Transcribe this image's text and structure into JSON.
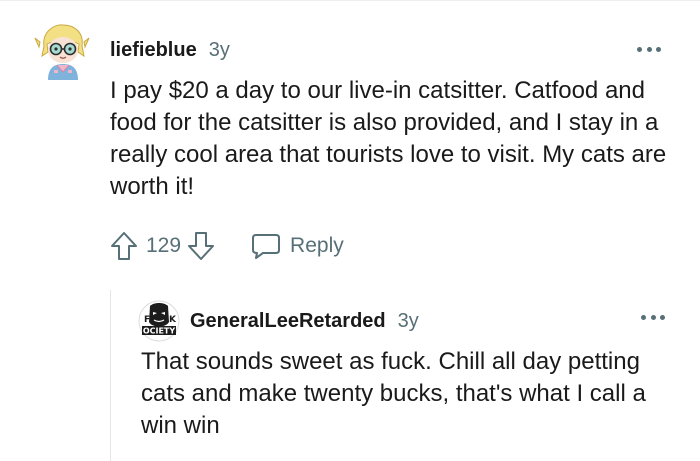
{
  "comments": [
    {
      "username": "liefieblue",
      "age": "3y",
      "body": "I pay $20 a day to our live-in catsitter. Catfood and food for the catsitter is also provided, and I stay in a really cool area that tourists love to visit. My cats are worth it!",
      "score": "129",
      "reply_label": "Reply",
      "avatar": "cartoon-snoo-avatar",
      "icons": {
        "upvote": "arrow-up-icon",
        "downvote": "arrow-down-icon",
        "reply": "speech-bubble-icon",
        "more": "ellipsis-icon"
      }
    },
    {
      "username": "GeneralLeeRetarded",
      "age": "3y",
      "body": "That sounds sweet as fuck. Chill all day petting cats and make twenty bucks, that's what I call a win win",
      "avatar": "f-k-society-mask-avatar",
      "avatar_text": [
        "F",
        "K",
        "OCIETY"
      ],
      "icons": {
        "more": "ellipsis-icon"
      }
    }
  ],
  "colors": {
    "text_primary": "#1a1a1b",
    "text_secondary": "#576f76",
    "thread_line": "#e6e6e6",
    "background": "#ffffff"
  }
}
